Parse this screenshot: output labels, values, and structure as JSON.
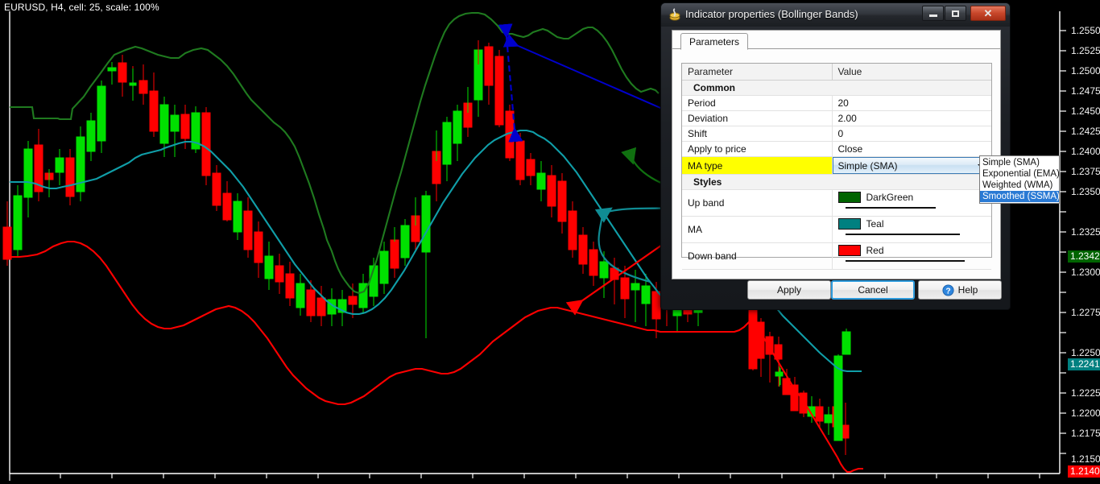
{
  "chart": {
    "title": "EURUSD, H4, cell: 25, scale: 100%",
    "symbol": "EURUSD",
    "timeframe": "H4",
    "cell": "25",
    "scale": "100%",
    "background": "#000000",
    "axis_color": "#ffffff"
  },
  "chart_data": {
    "type": "line",
    "title": "EURUSD, H4, cell: 25, scale: 100%",
    "xlabel": "",
    "ylabel": "",
    "ylim": [
      1.2135,
      1.2562
    ],
    "grid": false,
    "legend": "none",
    "y_ticks": [
      "1.2550",
      "1.2525",
      "1.2500",
      "1.2475",
      "1.2450",
      "1.2425",
      "1.2400",
      "1.2375",
      "1.2350",
      "1.2325",
      "1.2300",
      "1.2275",
      "1.2250",
      "1.2225",
      "1.2200",
      "1.2175",
      "1.2150"
    ],
    "price_badges": [
      {
        "value": "1.2342",
        "bg": "#006400",
        "fg": "#ffffff",
        "name": "upper-band-price"
      },
      {
        "value": "1.2241",
        "bg": "#008080",
        "fg": "#ffffff",
        "name": "ma-price"
      },
      {
        "value": "1.2140",
        "bg": "#ff0000",
        "fg": "#ffffff",
        "name": "lower-band-price"
      }
    ],
    "series": [
      {
        "name": "Up band",
        "color": "#1f7a1f"
      },
      {
        "name": "MA",
        "color": "#109ea8"
      },
      {
        "name": "Down band",
        "color": "#ff0000"
      }
    ],
    "candles": {
      "up_color": "#00e000",
      "down_color": "#ff0000"
    },
    "annotations": [
      {
        "name": "deviation-span-arrow",
        "color": "#0000cd",
        "style": "dashed",
        "heads": "both"
      },
      {
        "name": "up-band-pointer",
        "color": "#0000cd",
        "style": "solid",
        "heads": "start"
      },
      {
        "name": "upper-band-curve-arrow",
        "color": "#107010",
        "style": "solid",
        "heads": "start"
      },
      {
        "name": "ma-curve-arrow",
        "color": "#108c94",
        "style": "solid",
        "heads": "start"
      },
      {
        "name": "down-band-curve-arrow",
        "color": "#ff0000",
        "style": "solid",
        "heads": "start"
      }
    ]
  },
  "dialog": {
    "title": "Indicator properties (Bollinger Bands)",
    "icon": "indicator-icon",
    "window_buttons": {
      "minimize": "minimize-button",
      "maximize": "maximize-button",
      "close": "✕"
    },
    "tabs": [
      {
        "label": "Parameters",
        "active": true
      }
    ],
    "table": {
      "headers": [
        "Parameter",
        "Value"
      ],
      "rows": [
        {
          "kind": "group",
          "label": "Common"
        },
        {
          "kind": "text",
          "label": "Period",
          "value": "20"
        },
        {
          "kind": "text",
          "label": "Deviation",
          "value": "2.00"
        },
        {
          "kind": "text",
          "label": "Shift",
          "value": "0"
        },
        {
          "kind": "text",
          "label": "Apply to price",
          "value": "Close"
        },
        {
          "kind": "combo",
          "label": "MA type",
          "value": "Simple (SMA)",
          "highlighted": true
        },
        {
          "kind": "group",
          "label": "Styles"
        },
        {
          "kind": "style",
          "label": "Up band",
          "value": "DarkGreen",
          "color": "#006400",
          "line_width": 2
        },
        {
          "kind": "style",
          "label": "MA",
          "value": "Teal",
          "color": "#008080",
          "line_width": 2
        },
        {
          "kind": "style",
          "label": "Down band",
          "value": "Red",
          "color": "#ff0000",
          "line_width": 2
        }
      ]
    },
    "ma_dropdown": {
      "open": true,
      "options": [
        {
          "label": "Simple (SMA)",
          "selected": false
        },
        {
          "label": "Exponential (EMA)",
          "selected": false
        },
        {
          "label": "Weighted (WMA)",
          "selected": false
        },
        {
          "label": "Smoothed (SSMA)",
          "selected": true
        }
      ]
    },
    "buttons": {
      "apply": "Apply",
      "cancel": "Cancel",
      "help": "Help"
    },
    "accent_color": "#2e9bdc",
    "highlight_color": "#ffff00"
  }
}
